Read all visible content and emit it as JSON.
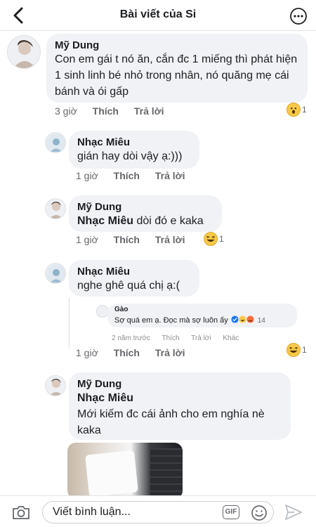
{
  "header": {
    "title": "Bài viết của Si"
  },
  "comments": [
    {
      "name": "Mỹ Dung",
      "text": "Con em gái t nó ăn, cắn đc 1 miếng thì phát hiện 1 sinh linh bé nhỏ trong nhân, nó quăng mẹ cái bánh và ói gấp",
      "time": "3 giờ",
      "like": "Thích",
      "reply": "Trả lời",
      "reaction_count": "1"
    },
    {
      "name": "Nhạc Miêu",
      "text": "gián hay dòi vậy ạ:)))",
      "time": "1 giờ",
      "like": "Thích",
      "reply": "Trả lời"
    },
    {
      "name": "Mỹ Dung",
      "mention": "Nhạc Miêu",
      "text": "dòi đó e kaka",
      "time": "1 giờ",
      "like": "Thích",
      "reply": "Trả lời",
      "reaction_count": "1"
    },
    {
      "name": "Nhạc Miêu",
      "text": "nghe ghê quá chị ạ:(",
      "time": "1 giờ",
      "like": "Thích",
      "reply": "Trả lời",
      "reaction_count": "1",
      "embedded": {
        "name": "Gào",
        "text": "Sợ quá em ạ. Đọc mà sợ luôn ấy",
        "reaction_count": "14",
        "time": "2 năm trước",
        "like": "Thích",
        "reply": "Trả lời",
        "other": "Khác"
      }
    },
    {
      "name": "Mỹ Dung",
      "mention": "Nhạc Miêu",
      "text": "Mới kiếm đc cái ảnh cho em nghía nè kaka"
    }
  ],
  "composer": {
    "placeholder": "Viết bình luận...",
    "gif_label": "GIF"
  },
  "icons": [
    "back-icon",
    "more-icon",
    "camera-icon",
    "gif-icon",
    "emoji-icon",
    "send-icon",
    "wow-emoji-icon",
    "laugh-emoji-icon",
    "verified-badge-icon"
  ],
  "colors": {
    "bubble": "#f0f2f5",
    "meta": "#65676b",
    "text": "#1c1e21",
    "emoji": "#f7c948",
    "verified": "#1877f2"
  }
}
